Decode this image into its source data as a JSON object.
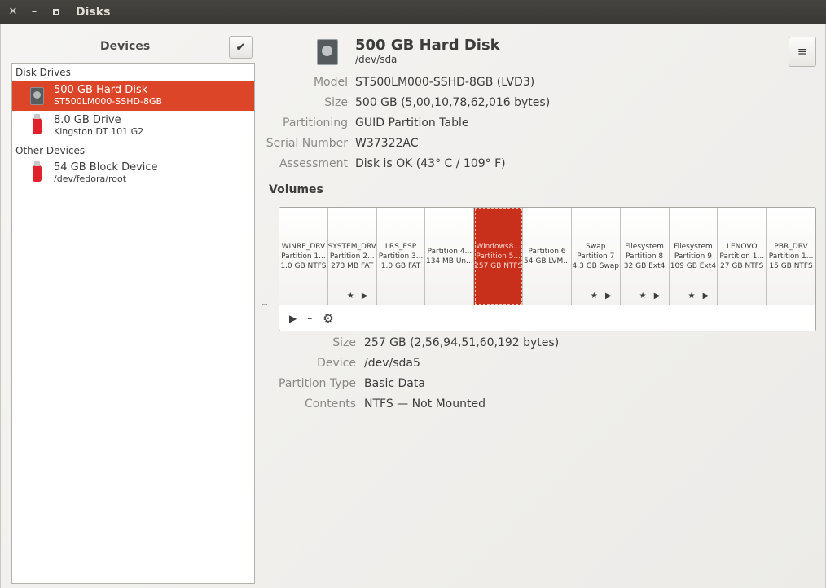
{
  "window": {
    "title": "Disks"
  },
  "sidebar": {
    "title": "Devices",
    "sections": [
      {
        "header": "Disk Drives"
      },
      {
        "header": "Other Devices"
      }
    ],
    "items": [
      {
        "title": "500 GB Hard Disk",
        "subtitle": "ST500LM000-SSHD-8GB",
        "icon": "hard-disk-icon"
      },
      {
        "title": "8.0 GB Drive",
        "subtitle": "Kingston DT 101 G2",
        "icon": "usb-drive-icon"
      },
      {
        "title": "54 GB Block Device",
        "subtitle": "/dev/fedora/root",
        "icon": "usb-drive-icon"
      }
    ]
  },
  "disk": {
    "title": "500 GB Hard Disk",
    "device": "/dev/sda",
    "properties": [
      {
        "label": "Model",
        "value": "ST500LM000-SSHD-8GB (LVD3)"
      },
      {
        "label": "Size",
        "value": "500 GB (5,00,10,78,62,016 bytes)"
      },
      {
        "label": "Partitioning",
        "value": "GUID Partition Table"
      },
      {
        "label": "Serial Number",
        "value": "W37322AC"
      },
      {
        "label": "Assessment",
        "value": "Disk is OK (43° C / 109° F)"
      }
    ]
  },
  "volumes": {
    "title": "Volumes",
    "items": [
      {
        "name": "WINRE_DRV",
        "part": "Partition 1...",
        "size": "1.0 GB NTFS",
        "marks": ""
      },
      {
        "name": "SYSTEM_DRV",
        "part": "Partition 2...",
        "size": "273 MB FAT",
        "marks": "★ ▶"
      },
      {
        "name": "LRS_ESP",
        "part": "Partition 3...",
        "size": "1.0 GB FAT",
        "marks": ""
      },
      {
        "name": "Partition 4...",
        "part": "134 MB Un...",
        "size": "",
        "marks": ""
      },
      {
        "name": "Windows8...",
        "part": "Partition 5...",
        "size": "257 GB NTFS",
        "marks": ""
      },
      {
        "name": "Partition 6",
        "part": "54 GB LVM...",
        "size": "",
        "marks": ""
      },
      {
        "name": "Swap",
        "part": "Partition 7",
        "size": "4.3 GB Swap",
        "marks": "★ ▶"
      },
      {
        "name": "Filesystem",
        "part": "Partition 8",
        "size": "32 GB Ext4",
        "marks": "★ ▶"
      },
      {
        "name": "Filesystem",
        "part": "Partition 9",
        "size": "109 GB Ext4",
        "marks": "★ ▶"
      },
      {
        "name": "LENOVO",
        "part": "Partition 1...",
        "size": "27 GB NTFS",
        "marks": ""
      },
      {
        "name": "PBR_DRV",
        "part": "Partition 1...",
        "size": "15 GB NTFS",
        "marks": ""
      }
    ],
    "toolbar": {
      "play": "▶",
      "minus": "–",
      "settings": "⚙"
    }
  },
  "selected_volume": {
    "properties": [
      {
        "label": "Size",
        "value": "257 GB (2,56,94,51,60,192 bytes)"
      },
      {
        "label": "Device",
        "value": "/dev/sda5"
      },
      {
        "label": "Partition Type",
        "value": "Basic Data"
      },
      {
        "label": "Contents",
        "value": "NTFS — Not Mounted"
      }
    ]
  },
  "colors": {
    "accent": "#dd4529",
    "selected_volume": "#c9301c"
  }
}
